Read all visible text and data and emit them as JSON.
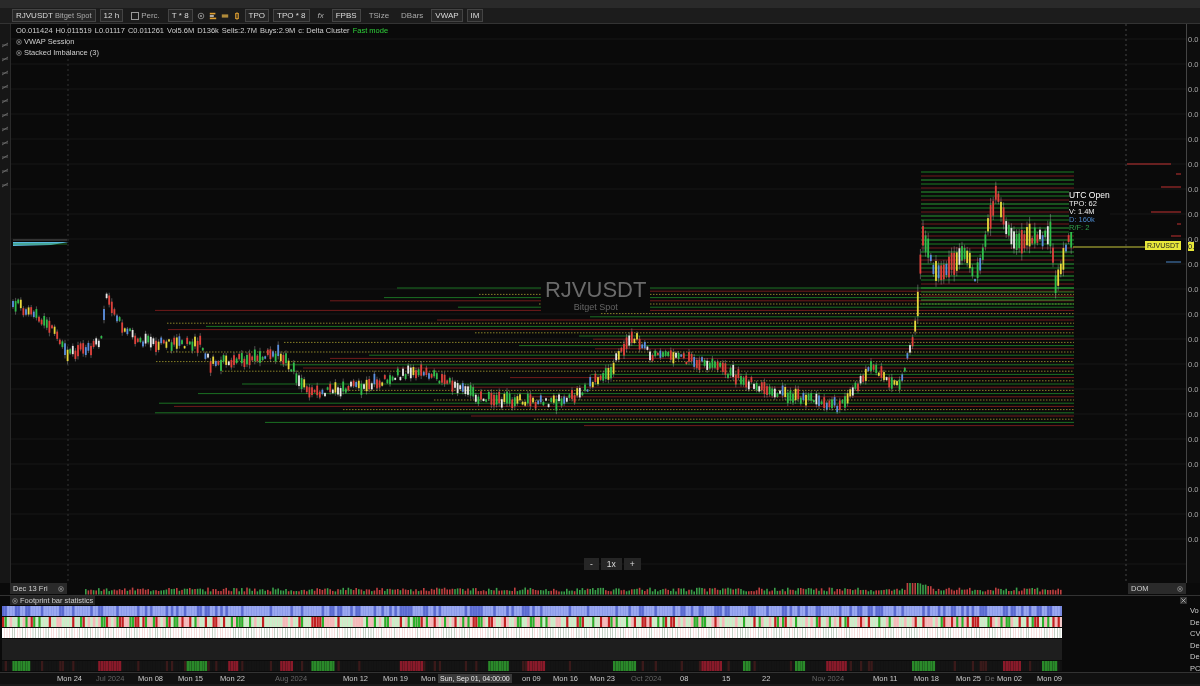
{
  "toolbar": {
    "symbol": "RJVUSDT",
    "exchange": "Bitget Spot",
    "interval": "12 h",
    "perc": {
      "label": "Perc.",
      "checked": false
    },
    "tick_multiplier": "T * 8",
    "mode": "TPO",
    "tpo_multiplier": "TPO * 8",
    "fx": "fx",
    "toggles": [
      {
        "label": "FPBS",
        "selected": true
      },
      {
        "label": "TSize",
        "selected": false
      },
      {
        "label": "DBars",
        "selected": false
      },
      {
        "label": "VWAP",
        "selected": true
      },
      {
        "label": "IM",
        "selected": true
      }
    ]
  },
  "legend": {
    "ohlc": [
      {
        "label": "O",
        "value": "0.011424"
      },
      {
        "label": "H",
        "value": "0.011519"
      },
      {
        "label": "L",
        "value": "0.01117"
      },
      {
        "label": "C",
        "value": "0.011261"
      },
      {
        "label": "Vol",
        "value": "5.6M"
      },
      {
        "label": "D",
        "value": "136k"
      },
      {
        "label": "Sells:",
        "value": "2.7M"
      },
      {
        "label": "Buys:",
        "value": "2.9M"
      }
    ],
    "cluster": "c: Delta Cluster",
    "cluster_mode": "Fast mode",
    "indicators": [
      "VWAP Session",
      "Stacked Imbalance (3)"
    ]
  },
  "chart": {
    "symbol": "RJVUSDT",
    "exchange": "Bitget Spot",
    "session_box": [
      {
        "text": "UTC Open",
        "kind": "title"
      },
      {
        "text": "TPO: 62",
        "kind": "stat"
      },
      {
        "text": "V: 1.4M",
        "kind": "stat"
      },
      {
        "text": "D: 160k",
        "kind": "delta"
      },
      {
        "text": "R/F: 2",
        "kind": "ratio"
      }
    ],
    "price_tag": "RJVUSDT",
    "price_value": "0."
  },
  "price_axis": [
    "0.0",
    "0.0",
    "0.0",
    "0.0",
    "0.0",
    "0.0",
    "0.0",
    "0.0",
    "0.0",
    "0.0",
    "0.0",
    "0.0",
    "0.0",
    "0.0",
    "0.0",
    "0.0",
    "0.0",
    "0.0",
    "0.0",
    "0.0",
    "0.0"
  ],
  "zoom_control": {
    "minus": "-",
    "value": "1x",
    "plus": "+"
  },
  "volume_panel": {
    "date_tab": "Dec 13 Fri",
    "dom_tab": "DOM"
  },
  "stats_panel": {
    "title": "Footprint bar statistics",
    "row_labels": [
      "Vo",
      "De",
      "CV",
      "De",
      "De",
      "PC"
    ]
  },
  "time_axis": [
    {
      "text": "Mon 24",
      "kind": "date"
    },
    {
      "text": "Jul 2024",
      "kind": "month"
    },
    {
      "text": "Mon 08",
      "kind": "date"
    },
    {
      "text": "Mon 15",
      "kind": "date"
    },
    {
      "text": "Mon 22",
      "kind": "date"
    },
    {
      "text": "Aug 2024",
      "kind": "month"
    },
    {
      "text": "Mon 12",
      "kind": "date"
    },
    {
      "text": "Mon 19",
      "kind": "date"
    },
    {
      "text": "Mon",
      "kind": "date"
    },
    {
      "text": "Sun, Sep 01, 04:00:00",
      "kind": "crosshair"
    },
    {
      "text": "on 09",
      "kind": "date"
    },
    {
      "text": "Mon 16",
      "kind": "date"
    },
    {
      "text": "Mon 23",
      "kind": "date"
    },
    {
      "text": "Oct 2024",
      "kind": "month"
    },
    {
      "text": "08",
      "kind": "date"
    },
    {
      "text": "15",
      "kind": "date"
    },
    {
      "text": "22",
      "kind": "date"
    },
    {
      "text": "Nov 2024",
      "kind": "month"
    },
    {
      "text": "Mon 11",
      "kind": "date"
    },
    {
      "text": "Mon 18",
      "kind": "date"
    },
    {
      "text": "Mon 25",
      "kind": "date"
    },
    {
      "text": "De",
      "kind": "month"
    },
    {
      "text": "Mon 02",
      "kind": "date"
    },
    {
      "text": "Mon 09",
      "kind": "date"
    }
  ]
}
